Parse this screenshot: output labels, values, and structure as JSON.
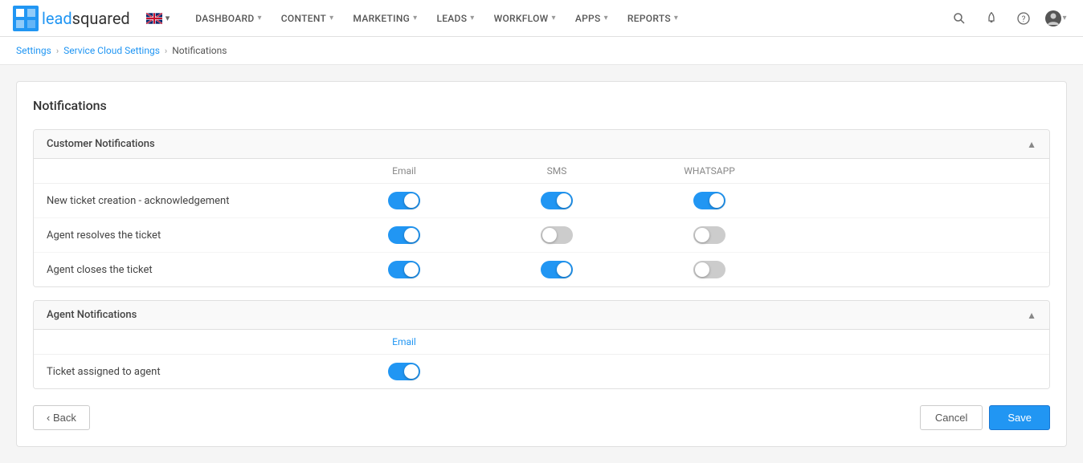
{
  "brand": {
    "logo_lead": "lead",
    "logo_squared": "squared",
    "full": "leadsquared"
  },
  "navbar": {
    "items": [
      {
        "key": "dashboard",
        "label": "DASHBOARD"
      },
      {
        "key": "content",
        "label": "CONTENT"
      },
      {
        "key": "marketing",
        "label": "MARKETING"
      },
      {
        "key": "leads",
        "label": "LEADS"
      },
      {
        "key": "workflow",
        "label": "WORKFLOW"
      },
      {
        "key": "apps",
        "label": "APPS"
      },
      {
        "key": "reports",
        "label": "REPORTS"
      }
    ],
    "lang": "EN"
  },
  "breadcrumb": {
    "items": [
      {
        "label": "Settings",
        "key": "settings"
      },
      {
        "label": "Service Cloud Settings",
        "key": "service-cloud-settings"
      },
      {
        "label": "Notifications",
        "key": "notifications",
        "current": true
      }
    ]
  },
  "page": {
    "title": "Notifications",
    "customer_section": {
      "header": "Customer Notifications",
      "col_email": "Email",
      "col_sms": "SMS",
      "col_whatsapp": "WHATSAPP",
      "rows": [
        {
          "label": "New ticket creation - acknowledgement",
          "email": true,
          "sms": true,
          "whatsapp": true
        },
        {
          "label": "Agent resolves the ticket",
          "email": true,
          "sms": false,
          "whatsapp": false
        },
        {
          "label": "Agent closes the ticket",
          "email": true,
          "sms": true,
          "whatsapp": false
        }
      ]
    },
    "agent_section": {
      "header": "Agent Notifications",
      "col_email": "Email",
      "rows": [
        {
          "label": "Ticket assigned to agent",
          "email": true
        }
      ]
    },
    "buttons": {
      "back": "‹ Back",
      "cancel": "Cancel",
      "save": "Save"
    }
  },
  "colors": {
    "toggle_on": "#2196F3",
    "toggle_off": "#cccccc",
    "accent": "#2196F3"
  }
}
